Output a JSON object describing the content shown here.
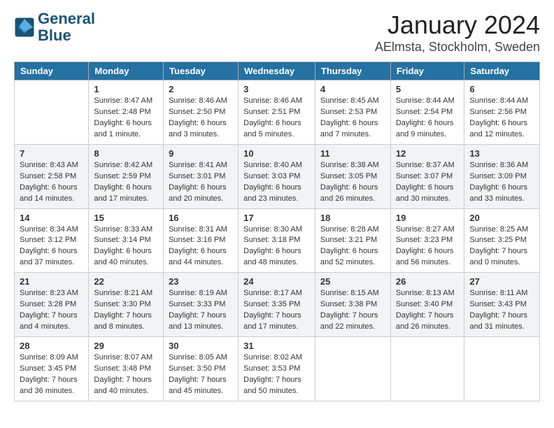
{
  "header": {
    "logo_line1": "General",
    "logo_line2": "Blue",
    "main_title": "January 2024",
    "sub_title": "AElmsta, Stockholm, Sweden"
  },
  "calendar": {
    "days_of_week": [
      "Sunday",
      "Monday",
      "Tuesday",
      "Wednesday",
      "Thursday",
      "Friday",
      "Saturday"
    ],
    "weeks": [
      [
        {
          "day": "",
          "info": ""
        },
        {
          "day": "1",
          "info": "Sunrise: 8:47 AM\nSunset: 2:48 PM\nDaylight: 6 hours\nand 1 minute."
        },
        {
          "day": "2",
          "info": "Sunrise: 8:46 AM\nSunset: 2:50 PM\nDaylight: 6 hours\nand 3 minutes."
        },
        {
          "day": "3",
          "info": "Sunrise: 8:46 AM\nSunset: 2:51 PM\nDaylight: 6 hours\nand 5 minutes."
        },
        {
          "day": "4",
          "info": "Sunrise: 8:45 AM\nSunset: 2:53 PM\nDaylight: 6 hours\nand 7 minutes."
        },
        {
          "day": "5",
          "info": "Sunrise: 8:44 AM\nSunset: 2:54 PM\nDaylight: 6 hours\nand 9 minutes."
        },
        {
          "day": "6",
          "info": "Sunrise: 8:44 AM\nSunset: 2:56 PM\nDaylight: 6 hours\nand 12 minutes."
        }
      ],
      [
        {
          "day": "7",
          "info": "Sunrise: 8:43 AM\nSunset: 2:58 PM\nDaylight: 6 hours\nand 14 minutes."
        },
        {
          "day": "8",
          "info": "Sunrise: 8:42 AM\nSunset: 2:59 PM\nDaylight: 6 hours\nand 17 minutes."
        },
        {
          "day": "9",
          "info": "Sunrise: 8:41 AM\nSunset: 3:01 PM\nDaylight: 6 hours\nand 20 minutes."
        },
        {
          "day": "10",
          "info": "Sunrise: 8:40 AM\nSunset: 3:03 PM\nDaylight: 6 hours\nand 23 minutes."
        },
        {
          "day": "11",
          "info": "Sunrise: 8:38 AM\nSunset: 3:05 PM\nDaylight: 6 hours\nand 26 minutes."
        },
        {
          "day": "12",
          "info": "Sunrise: 8:37 AM\nSunset: 3:07 PM\nDaylight: 6 hours\nand 30 minutes."
        },
        {
          "day": "13",
          "info": "Sunrise: 8:36 AM\nSunset: 3:09 PM\nDaylight: 6 hours\nand 33 minutes."
        }
      ],
      [
        {
          "day": "14",
          "info": "Sunrise: 8:34 AM\nSunset: 3:12 PM\nDaylight: 6 hours\nand 37 minutes."
        },
        {
          "day": "15",
          "info": "Sunrise: 8:33 AM\nSunset: 3:14 PM\nDaylight: 6 hours\nand 40 minutes."
        },
        {
          "day": "16",
          "info": "Sunrise: 8:31 AM\nSunset: 3:16 PM\nDaylight: 6 hours\nand 44 minutes."
        },
        {
          "day": "17",
          "info": "Sunrise: 8:30 AM\nSunset: 3:18 PM\nDaylight: 6 hours\nand 48 minutes."
        },
        {
          "day": "18",
          "info": "Sunrise: 8:28 AM\nSunset: 3:21 PM\nDaylight: 6 hours\nand 52 minutes."
        },
        {
          "day": "19",
          "info": "Sunrise: 8:27 AM\nSunset: 3:23 PM\nDaylight: 6 hours\nand 56 minutes."
        },
        {
          "day": "20",
          "info": "Sunrise: 8:25 AM\nSunset: 3:25 PM\nDaylight: 7 hours\nand 0 minutes."
        }
      ],
      [
        {
          "day": "21",
          "info": "Sunrise: 8:23 AM\nSunset: 3:28 PM\nDaylight: 7 hours\nand 4 minutes."
        },
        {
          "day": "22",
          "info": "Sunrise: 8:21 AM\nSunset: 3:30 PM\nDaylight: 7 hours\nand 8 minutes."
        },
        {
          "day": "23",
          "info": "Sunrise: 8:19 AM\nSunset: 3:33 PM\nDaylight: 7 hours\nand 13 minutes."
        },
        {
          "day": "24",
          "info": "Sunrise: 8:17 AM\nSunset: 3:35 PM\nDaylight: 7 hours\nand 17 minutes."
        },
        {
          "day": "25",
          "info": "Sunrise: 8:15 AM\nSunset: 3:38 PM\nDaylight: 7 hours\nand 22 minutes."
        },
        {
          "day": "26",
          "info": "Sunrise: 8:13 AM\nSunset: 3:40 PM\nDaylight: 7 hours\nand 26 minutes."
        },
        {
          "day": "27",
          "info": "Sunrise: 8:11 AM\nSunset: 3:43 PM\nDaylight: 7 hours\nand 31 minutes."
        }
      ],
      [
        {
          "day": "28",
          "info": "Sunrise: 8:09 AM\nSunset: 3:45 PM\nDaylight: 7 hours\nand 36 minutes."
        },
        {
          "day": "29",
          "info": "Sunrise: 8:07 AM\nSunset: 3:48 PM\nDaylight: 7 hours\nand 40 minutes."
        },
        {
          "day": "30",
          "info": "Sunrise: 8:05 AM\nSunset: 3:50 PM\nDaylight: 7 hours\nand 45 minutes."
        },
        {
          "day": "31",
          "info": "Sunrise: 8:02 AM\nSunset: 3:53 PM\nDaylight: 7 hours\nand 50 minutes."
        },
        {
          "day": "",
          "info": ""
        },
        {
          "day": "",
          "info": ""
        },
        {
          "day": "",
          "info": ""
        }
      ]
    ]
  }
}
